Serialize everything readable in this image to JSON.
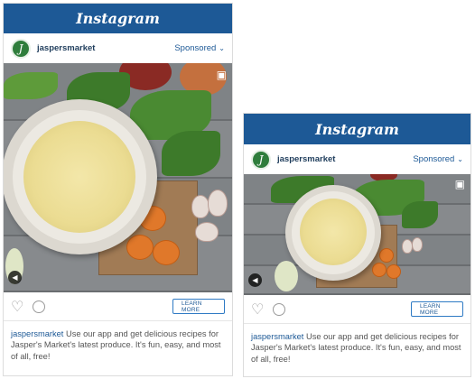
{
  "platform_name": "Instagram",
  "account": {
    "username": "jaspersmarket",
    "avatar_letter": "J"
  },
  "sponsored_label": "Sponsored",
  "cta_label": "LEARN MORE",
  "caption_text": "Use our app and get delicious recipes for Jasper's Market's latest produce. It's fun, easy, and most of all, free!",
  "colors": {
    "header_blue": "#1d5996",
    "avatar_green": "#2f7d3c",
    "cta_border": "#2e7ac4"
  },
  "icons": [
    "video-camera-icon",
    "sound-off-icon",
    "heart-icon",
    "comment-icon",
    "chevron-down-icon"
  ]
}
